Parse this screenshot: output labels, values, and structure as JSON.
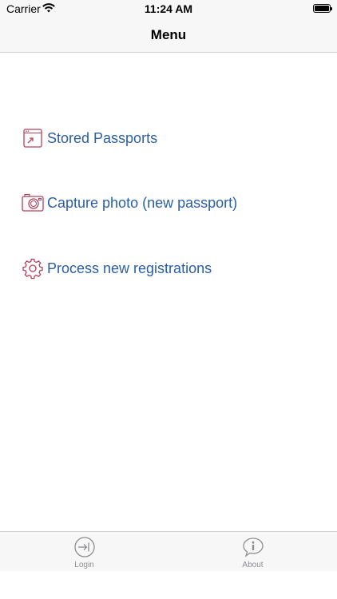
{
  "status_bar": {
    "carrier": "Carrier",
    "time": "11:24 AM",
    "icons": [
      "wifi-icon",
      "battery-icon"
    ]
  },
  "nav": {
    "title": "Menu"
  },
  "menu": {
    "items": [
      {
        "label": "Stored Passports",
        "icon": "stored-passports-icon"
      },
      {
        "label": "Capture photo (new passport)",
        "icon": "camera-icon"
      },
      {
        "label": "Process new registrations",
        "icon": "gear-icon"
      }
    ]
  },
  "tabs": [
    {
      "label": "Login",
      "icon": "login-icon"
    },
    {
      "label": "About",
      "icon": "about-icon"
    }
  ],
  "colors": {
    "link_text": "#2b5ea3",
    "icon_stroke": "#b5405a",
    "tab_inactive": "#8e8e93",
    "bar_background": "#f7f7f7"
  }
}
